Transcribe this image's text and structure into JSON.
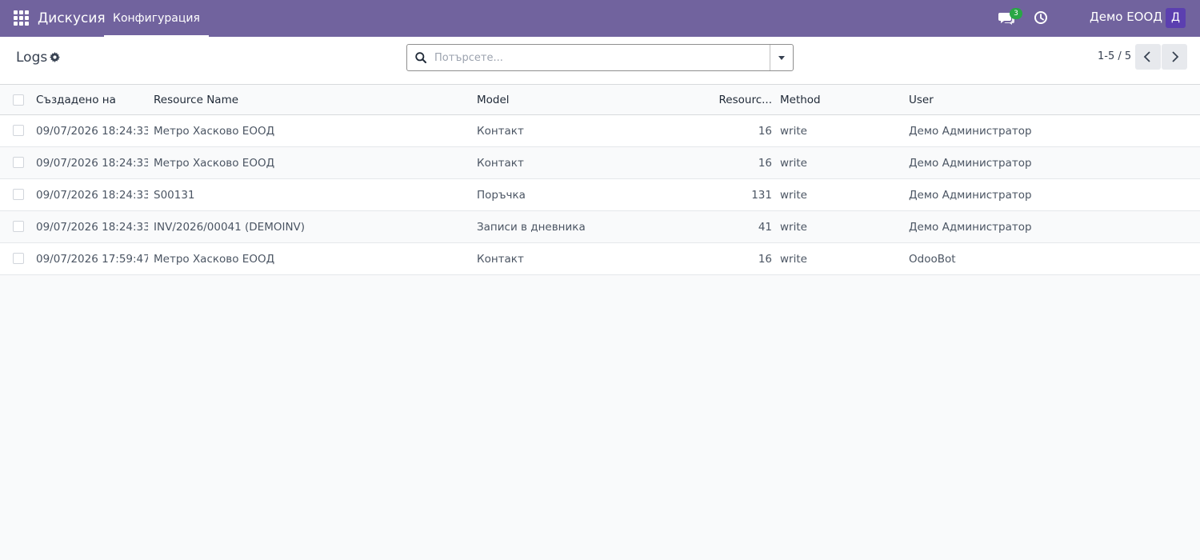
{
  "navbar": {
    "app_name": "Дискусия",
    "menu_label": "Конфигурация",
    "chat_badge": "3",
    "company": "Демо ЕООД",
    "avatar_letter": "Д",
    "bg_color": "#71639e"
  },
  "control_panel": {
    "title": "Logs",
    "search_placeholder": "Потърсете...",
    "pager": "1-5 / 5"
  },
  "table": {
    "columns": [
      "Създадено на",
      "Resource Name",
      "Model",
      "Resourc...",
      "Method",
      "User"
    ],
    "rows": [
      {
        "date": "09/07/2026 18:24:33",
        "name": "Метро Хасково ЕООД",
        "model": "Контакт",
        "res_id": "16",
        "method": "write",
        "user": "Демо Администратор"
      },
      {
        "date": "09/07/2026 18:24:33",
        "name": "Метро Хасково ЕООД",
        "model": "Контакт",
        "res_id": "16",
        "method": "write",
        "user": "Демо Администратор"
      },
      {
        "date": "09/07/2026 18:24:33",
        "name": "S00131",
        "model": "Поръчка",
        "res_id": "131",
        "method": "write",
        "user": "Демо Администратор"
      },
      {
        "date": "09/07/2026 18:24:33",
        "name": "INV/2026/00041 (DEMOINV)",
        "model": "Записи в дневника",
        "res_id": "41",
        "method": "write",
        "user": "Демо Администратор"
      },
      {
        "date": "09/07/2026 17:59:47",
        "name": "Метро Хасково ЕООД",
        "model": "Контакт",
        "res_id": "16",
        "method": "write",
        "user": "OdooBot"
      }
    ]
  }
}
